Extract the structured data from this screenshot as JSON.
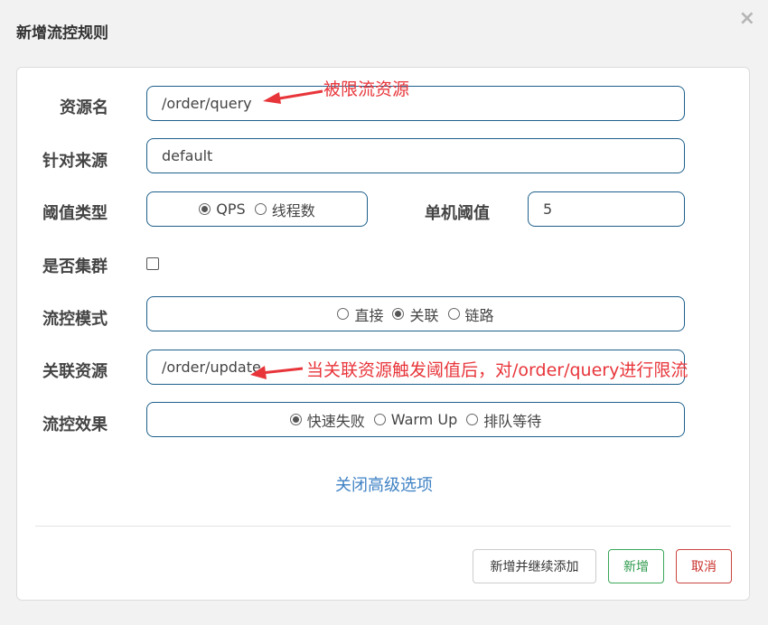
{
  "dialog": {
    "title": "新增流控规则",
    "close_symbol": "×"
  },
  "form": {
    "resource_label": "资源名",
    "resource_value": "/order/query",
    "source_label": "针对来源",
    "source_value": "default",
    "threshold_type_label": "阈值类型",
    "threshold_type_options": [
      "QPS",
      "线程数"
    ],
    "threshold_type_selected": "QPS",
    "single_threshold_label": "单机阈值",
    "single_threshold_value": "5",
    "cluster_label": "是否集群",
    "cluster_checked": false,
    "flow_mode_label": "流控模式",
    "flow_mode_options": [
      "直接",
      "关联",
      "链路"
    ],
    "flow_mode_selected": "关联",
    "related_resource_label": "关联资源",
    "related_resource_value": "/order/update",
    "effect_label": "流控效果",
    "effect_options": [
      "快速失败",
      "Warm Up",
      "排队等待"
    ],
    "effect_selected": "快速失败",
    "advanced_toggle": "关闭高级选项"
  },
  "annotations": {
    "resource_note": "被限流资源",
    "related_note": "当关联资源触发阈值后，对/order/query进行限流",
    "color": "#e8353a"
  },
  "footer": {
    "add_continue_label": "新增并继续添加",
    "add_label": "新增",
    "cancel_label": "取消"
  }
}
